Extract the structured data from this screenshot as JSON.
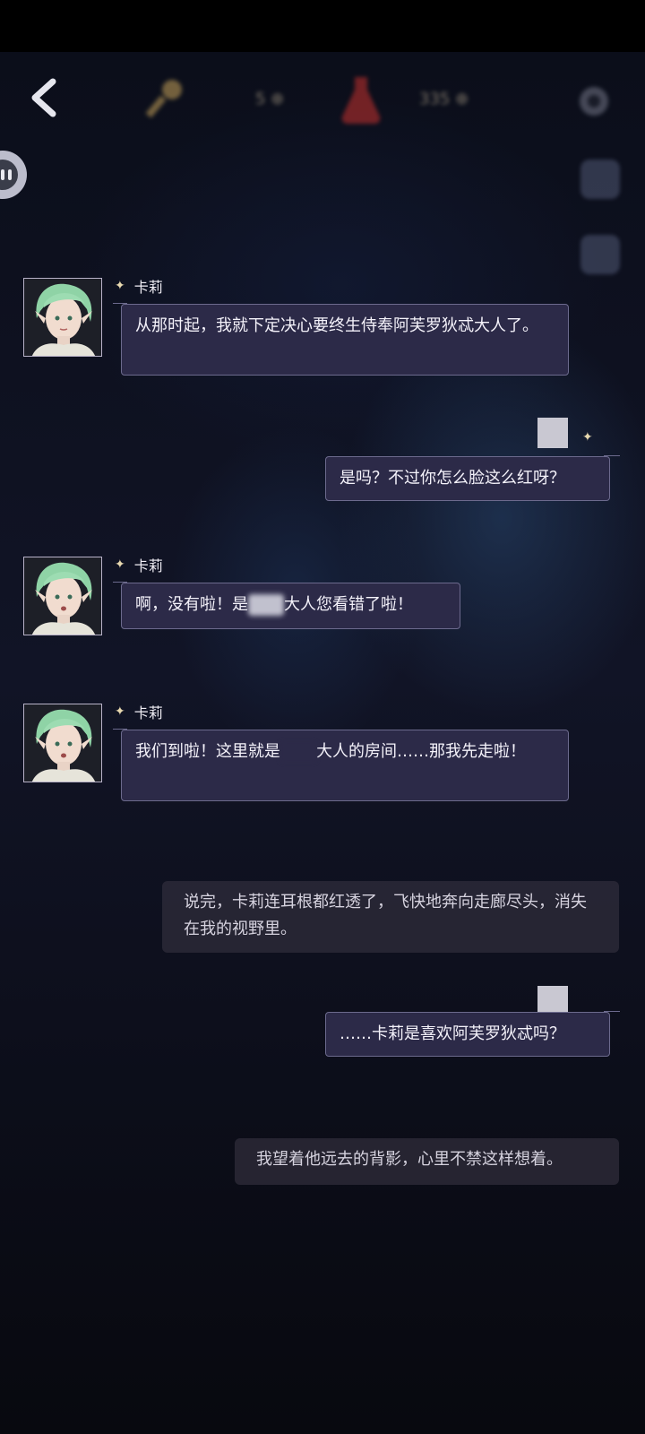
{
  "header": {
    "back_label": "back",
    "hud_value_1": "5 ⊕",
    "hud_value_2": "335 ⊕"
  },
  "speaker": {
    "name": "卡莉"
  },
  "messages": [
    {
      "type": "npc",
      "name": "卡莉",
      "text": "从那时起，我就下定决心要终生侍奉阿芙罗狄忒大人了。"
    },
    {
      "type": "self",
      "text": "是吗？不过你怎么脸这么红呀？"
    },
    {
      "type": "npc",
      "name": "卡莉",
      "text_before": "啊，没有啦！是",
      "text_after": "大人您看错了啦！"
    },
    {
      "type": "npc",
      "name": "卡莉",
      "text_before": "我们到啦！这里就是",
      "text_after": "大人的房间……那我先走啦！"
    },
    {
      "type": "narration",
      "text": "说完，卡莉连耳根都红透了，飞快地奔向走廊尽头，消失在我的视野里。"
    },
    {
      "type": "self",
      "text": "……卡莉是喜欢阿芙罗狄忒吗？"
    },
    {
      "type": "narration",
      "text": "我望着他远去的背影，心里不禁这样想着。"
    }
  ],
  "colors": {
    "bubble_bg": "#2c2a48",
    "bubble_border": "#6c6a8d",
    "accent_star": "#e8d9b0",
    "hair_green": "#8fd3a6"
  },
  "icons": {
    "back": "chevron-left-icon",
    "key": "key-icon",
    "flask": "flask-icon",
    "settings": "gear-icon",
    "pause": "pause-icon",
    "star": "sparkle-icon"
  }
}
